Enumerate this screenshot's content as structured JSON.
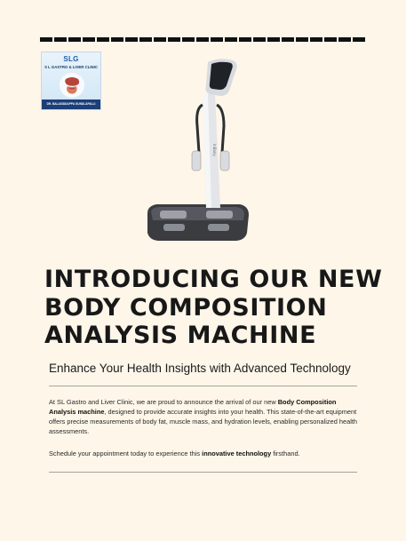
{
  "logo": {
    "mark": "SLG",
    "name": "S L GASTRO & LIVER CLINIC",
    "footer": "DR. BALASIDDAPPA GUNDLAPALLI"
  },
  "headline": {
    "line1": "INTRODUCING OUR NEW",
    "line2": "BODY COMPOSITION",
    "line3": "ANALYSIS MACHINE"
  },
  "subheadline": "Enhance Your Health Insights with Advanced Technology",
  "paragraph1": {
    "part1": "At SL Gastro and Liver Clinic, we are proud to announce the arrival of our new ",
    "bold1": "Body Composition Analysis machine",
    "part2": ", designed to provide accurate insights into your health. This state-of-the-art equipment offers precise measurements of body fat, muscle mass, and hydration levels, enabling personalized health assessments."
  },
  "paragraph2": {
    "part1": "Schedule your appointment today to experience this ",
    "bold1": "innovative technology",
    "part2": " firsthand."
  },
  "device": {
    "brand_text": "InBody"
  },
  "colors": {
    "background": "#fdf6e9",
    "text": "#1b1b1b",
    "rule": "#111111",
    "divider": "#a9a59c"
  }
}
